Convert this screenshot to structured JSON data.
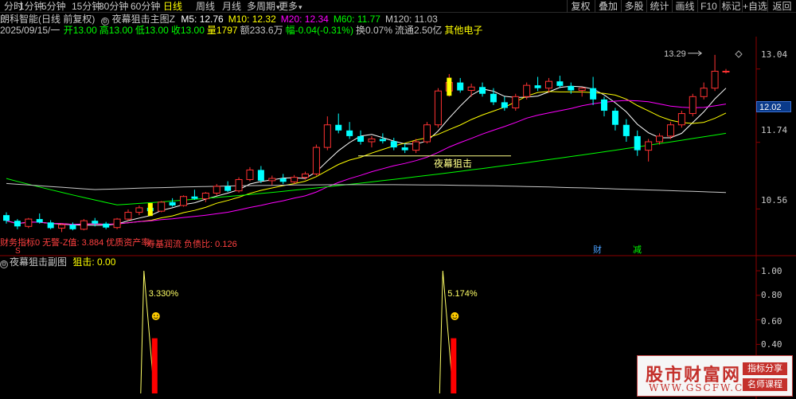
{
  "toolbar": {
    "periods": [
      "分时",
      "1分钟",
      "5分钟",
      "15分钟",
      "30分钟",
      "60分钟",
      "日线",
      "周线",
      "月线",
      "多周期",
      "更多"
    ],
    "active_period": "日线",
    "right_buttons": [
      "复权",
      "叠加",
      "多股",
      "统计",
      "画线",
      "F10",
      "标记",
      "+自选",
      "返回"
    ]
  },
  "main": {
    "stock_name": "朗科智能(日线 前复权)",
    "indicator_name": "夜幕狙击主图Z",
    "ma": [
      {
        "label": "M5:",
        "value": "12.76",
        "color": "#ffffff"
      },
      {
        "label": "M10:",
        "value": "12.32",
        "color": "#ffff00"
      },
      {
        "label": "M20:",
        "value": "12.34",
        "color": "#ff00ff"
      },
      {
        "label": "M60:",
        "value": "11.77",
        "color": "#00ff00"
      },
      {
        "label": "M120:",
        "value": "11.03",
        "color": "#c8c8c8"
      }
    ],
    "date": "2025/09/15/一",
    "quote": [
      {
        "text": "开13.00",
        "color": "#00ff00"
      },
      {
        "text": "高13.00",
        "color": "#00ff00"
      },
      {
        "text": "低13.00",
        "color": "#00ff00"
      },
      {
        "text": "收13.00",
        "color": "#00ff00"
      },
      {
        "text": "量1797",
        "color": "#ffff00"
      },
      {
        "text": "额233.6万",
        "color": "#c8c8c8"
      },
      {
        "text": "幅-0.04(-0.31%)",
        "color": "#00ff00"
      },
      {
        "text": "换0.07%",
        "color": "#c8c8c8"
      },
      {
        "text": "流通2.50亿",
        "color": "#c8c8c8"
      },
      {
        "text": "其他电子",
        "color": "#ffff00"
      }
    ],
    "price_axis": [
      "13.04",
      "11.74",
      "10.56"
    ],
    "current_price": "12.02",
    "high_marker": "13.29",
    "signal_label": "夜幕狙击",
    "bottom_text_1": "财务指标0 无警-Z值: 3.884 优质资产率",
    "bottom_text_2": "寿基润流 负债比: 0.126",
    "marker_s": "S",
    "marker_cai": "财",
    "marker_jian": "减"
  },
  "sub": {
    "title": "夜幕狙击副图",
    "value_label": "狙击: 0.00",
    "axis": [
      "1.00",
      "0.80",
      "0.60",
      "0.40"
    ],
    "spike1_pct": "3.330%",
    "spike2_pct": "5.174%"
  },
  "watermark": {
    "title": "股市财富网",
    "url": "WWW.GSCFW.COM",
    "tag1": "指标分享",
    "tag2": "名师课程"
  },
  "colors": {
    "up": "#ff3232",
    "down": "#00ffff",
    "ma5": "#ffffff",
    "ma10": "#ffff00",
    "ma20": "#ff00ff",
    "ma60": "#00ff00",
    "ma120": "#c8c8c8"
  },
  "chart_data": {
    "type": "candlestick",
    "price_range": [
      10.0,
      13.5
    ],
    "candles": [
      [
        10.45,
        10.5,
        10.3,
        10.35
      ],
      [
        10.35,
        10.38,
        10.2,
        10.25
      ],
      [
        10.25,
        10.4,
        10.22,
        10.38
      ],
      [
        10.38,
        10.48,
        10.3,
        10.32
      ],
      [
        10.32,
        10.36,
        10.2,
        10.22
      ],
      [
        10.22,
        10.3,
        10.15,
        10.28
      ],
      [
        10.28,
        10.32,
        10.18,
        10.2
      ],
      [
        10.2,
        10.38,
        10.18,
        10.35
      ],
      [
        10.35,
        10.4,
        10.25,
        10.3
      ],
      [
        10.3,
        10.33,
        10.2,
        10.23
      ],
      [
        10.23,
        10.4,
        10.2,
        10.38
      ],
      [
        10.38,
        10.55,
        10.35,
        10.5
      ],
      [
        10.5,
        10.62,
        10.45,
        10.58
      ],
      [
        10.58,
        10.65,
        10.5,
        10.52
      ],
      [
        10.52,
        10.7,
        10.5,
        10.68
      ],
      [
        10.68,
        10.75,
        10.6,
        10.62
      ],
      [
        10.62,
        10.8,
        10.6,
        10.78
      ],
      [
        10.78,
        10.9,
        10.72,
        10.74
      ],
      [
        10.74,
        10.86,
        10.68,
        10.84
      ],
      [
        10.84,
        11.0,
        10.8,
        10.96
      ],
      [
        10.96,
        11.05,
        10.86,
        10.88
      ],
      [
        10.88,
        11.12,
        10.85,
        11.08
      ],
      [
        11.08,
        11.3,
        11.05,
        11.25
      ],
      [
        11.25,
        11.32,
        11.02,
        11.06
      ],
      [
        11.06,
        11.15,
        10.98,
        11.1
      ],
      [
        11.1,
        11.18,
        11.0,
        11.04
      ],
      [
        11.04,
        11.16,
        11.0,
        11.12
      ],
      [
        11.12,
        11.22,
        11.08,
        11.18
      ],
      [
        11.18,
        11.7,
        11.15,
        11.65
      ],
      [
        11.65,
        12.2,
        11.6,
        12.05
      ],
      [
        12.05,
        12.25,
        11.9,
        11.95
      ],
      [
        11.95,
        12.1,
        11.8,
        11.85
      ],
      [
        11.85,
        11.95,
        11.7,
        11.75
      ],
      [
        11.75,
        11.85,
        11.65,
        11.8
      ],
      [
        11.8,
        11.9,
        11.72,
        11.76
      ],
      [
        11.76,
        11.82,
        11.6,
        11.65
      ],
      [
        11.65,
        11.72,
        11.55,
        11.6
      ],
      [
        11.6,
        11.8,
        11.55,
        11.75
      ],
      [
        11.75,
        12.1,
        11.72,
        12.05
      ],
      [
        12.05,
        12.7,
        12.0,
        12.65
      ],
      [
        12.65,
        12.95,
        12.55,
        12.8
      ],
      [
        12.8,
        12.88,
        12.62,
        12.66
      ],
      [
        12.66,
        12.78,
        12.55,
        12.72
      ],
      [
        12.72,
        12.8,
        12.55,
        12.6
      ],
      [
        12.6,
        12.7,
        12.4,
        12.45
      ],
      [
        12.45,
        12.55,
        12.3,
        12.35
      ],
      [
        12.35,
        12.6,
        12.3,
        12.55
      ],
      [
        12.55,
        12.8,
        12.5,
        12.75
      ],
      [
        12.75,
        12.9,
        12.65,
        12.7
      ],
      [
        12.7,
        12.88,
        12.62,
        12.82
      ],
      [
        12.82,
        12.92,
        12.7,
        12.74
      ],
      [
        12.74,
        12.8,
        12.6,
        12.66
      ],
      [
        12.66,
        12.72,
        12.55,
        12.7
      ],
      [
        12.7,
        12.9,
        12.4,
        12.5
      ],
      [
        12.5,
        12.55,
        12.2,
        12.3
      ],
      [
        12.3,
        12.35,
        11.95,
        12.05
      ],
      [
        12.05,
        12.15,
        11.75,
        11.85
      ],
      [
        11.85,
        11.95,
        11.5,
        11.6
      ],
      [
        11.6,
        11.8,
        11.4,
        11.75
      ],
      [
        11.75,
        11.9,
        11.7,
        11.85
      ],
      [
        11.85,
        12.1,
        11.8,
        12.05
      ],
      [
        12.05,
        12.3,
        12.0,
        12.25
      ],
      [
        12.25,
        12.6,
        12.2,
        12.55
      ],
      [
        12.55,
        12.8,
        12.5,
        12.7
      ],
      [
        12.7,
        13.29,
        12.65,
        13.0
      ],
      [
        13.0,
        13.04,
        12.96,
        13.0
      ]
    ],
    "sub_spikes": [
      {
        "index": 13,
        "value": 1.0,
        "bar": 0.45
      },
      {
        "index": 40,
        "value": 1.0,
        "bar": 0.45
      }
    ]
  }
}
